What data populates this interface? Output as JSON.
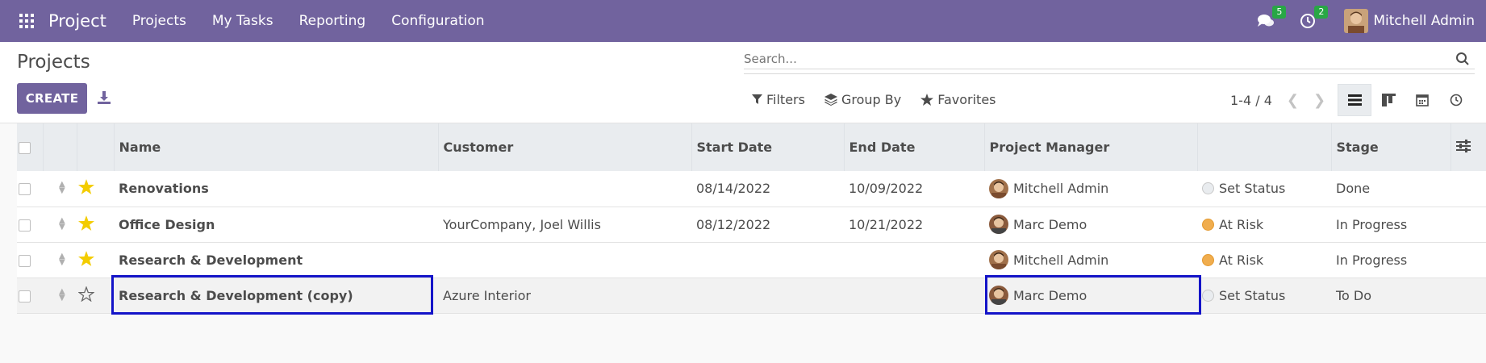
{
  "navbar": {
    "app_name": "Project",
    "menu": [
      "Projects",
      "My Tasks",
      "Reporting",
      "Configuration"
    ],
    "messages_count": "5",
    "activities_count": "2",
    "user_name": "Mitchell Admin",
    "bg_color": "#71639e"
  },
  "control_panel": {
    "title": "Projects",
    "create_label": "CREATE",
    "search_placeholder": "Search...",
    "filters_label": "Filters",
    "groupby_label": "Group By",
    "favorites_label": "Favorites",
    "pager": "1-4 / 4"
  },
  "table": {
    "headers": {
      "name": "Name",
      "customer": "Customer",
      "start": "Start Date",
      "end": "End Date",
      "manager": "Project Manager",
      "status": "",
      "stage": "Stage"
    },
    "rows": [
      {
        "favorite": true,
        "name": "Renovations",
        "customer": "",
        "start": "08/14/2022",
        "end": "10/09/2022",
        "manager": "Mitchell Admin",
        "status": "Set Status",
        "status_color": "gray",
        "stage": "Done"
      },
      {
        "favorite": true,
        "name": "Office Design",
        "customer": "YourCompany, Joel Willis",
        "start": "08/12/2022",
        "end": "10/21/2022",
        "manager": "Marc Demo",
        "status": "At Risk",
        "status_color": "orange",
        "stage": "In Progress"
      },
      {
        "favorite": true,
        "name": "Research & Development",
        "customer": "",
        "start": "",
        "end": "",
        "manager": "Mitchell Admin",
        "status": "At Risk",
        "status_color": "orange",
        "stage": "In Progress"
      },
      {
        "favorite": false,
        "name": "Research & Development (copy)",
        "customer": "Azure Interior",
        "start": "",
        "end": "",
        "manager": "Marc Demo",
        "status": "Set Status",
        "status_color": "gray",
        "stage": "To Do"
      }
    ]
  }
}
